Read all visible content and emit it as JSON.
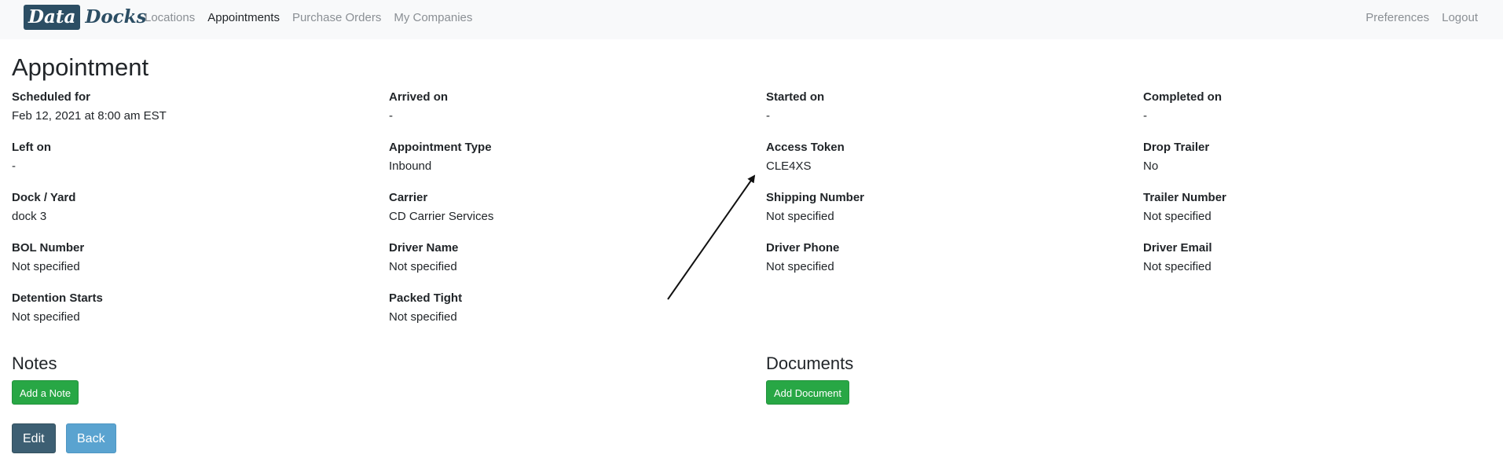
{
  "nav": {
    "brand_part1": "Data",
    "brand_part2": "Docks",
    "links": [
      "Locations",
      "Appointments",
      "Purchase Orders",
      "My Companies"
    ],
    "right_links": [
      "Preferences",
      "Logout"
    ]
  },
  "page": {
    "title": "Appointment"
  },
  "fields": [
    {
      "label": "Scheduled for",
      "value": "Feb 12, 2021 at 8:00 am EST"
    },
    {
      "label": "Arrived on",
      "value": "-"
    },
    {
      "label": "Started on",
      "value": "-"
    },
    {
      "label": "Completed on",
      "value": "-"
    },
    {
      "label": "Left on",
      "value": "-"
    },
    {
      "label": "Appointment Type",
      "value": "Inbound"
    },
    {
      "label": "Access Token",
      "value": "CLE4XS"
    },
    {
      "label": "Drop Trailer",
      "value": "No"
    },
    {
      "label": "Dock / Yard",
      "value": "dock 3"
    },
    {
      "label": "Carrier",
      "value": "CD Carrier Services"
    },
    {
      "label": "Shipping Number",
      "value": "Not specified"
    },
    {
      "label": "Trailer Number",
      "value": "Not specified"
    },
    {
      "label": "BOL Number",
      "value": "Not specified"
    },
    {
      "label": "Driver Name",
      "value": "Not specified"
    },
    {
      "label": "Driver Phone",
      "value": "Not specified"
    },
    {
      "label": "Driver Email",
      "value": "Not specified"
    },
    {
      "label": "Detention Starts",
      "value": "Not specified"
    },
    {
      "label": "Packed Tight",
      "value": "Not specified"
    }
  ],
  "notes": {
    "title": "Notes",
    "add_label": "Add a Note"
  },
  "documents": {
    "title": "Documents",
    "add_label": "Add Document"
  },
  "actions": {
    "edit_label": "Edit",
    "back_label": "Back"
  },
  "colors": {
    "brand": "#2c4e64",
    "success": "#28a745",
    "edit": "#3d5f73",
    "back": "#5aa3d0"
  }
}
